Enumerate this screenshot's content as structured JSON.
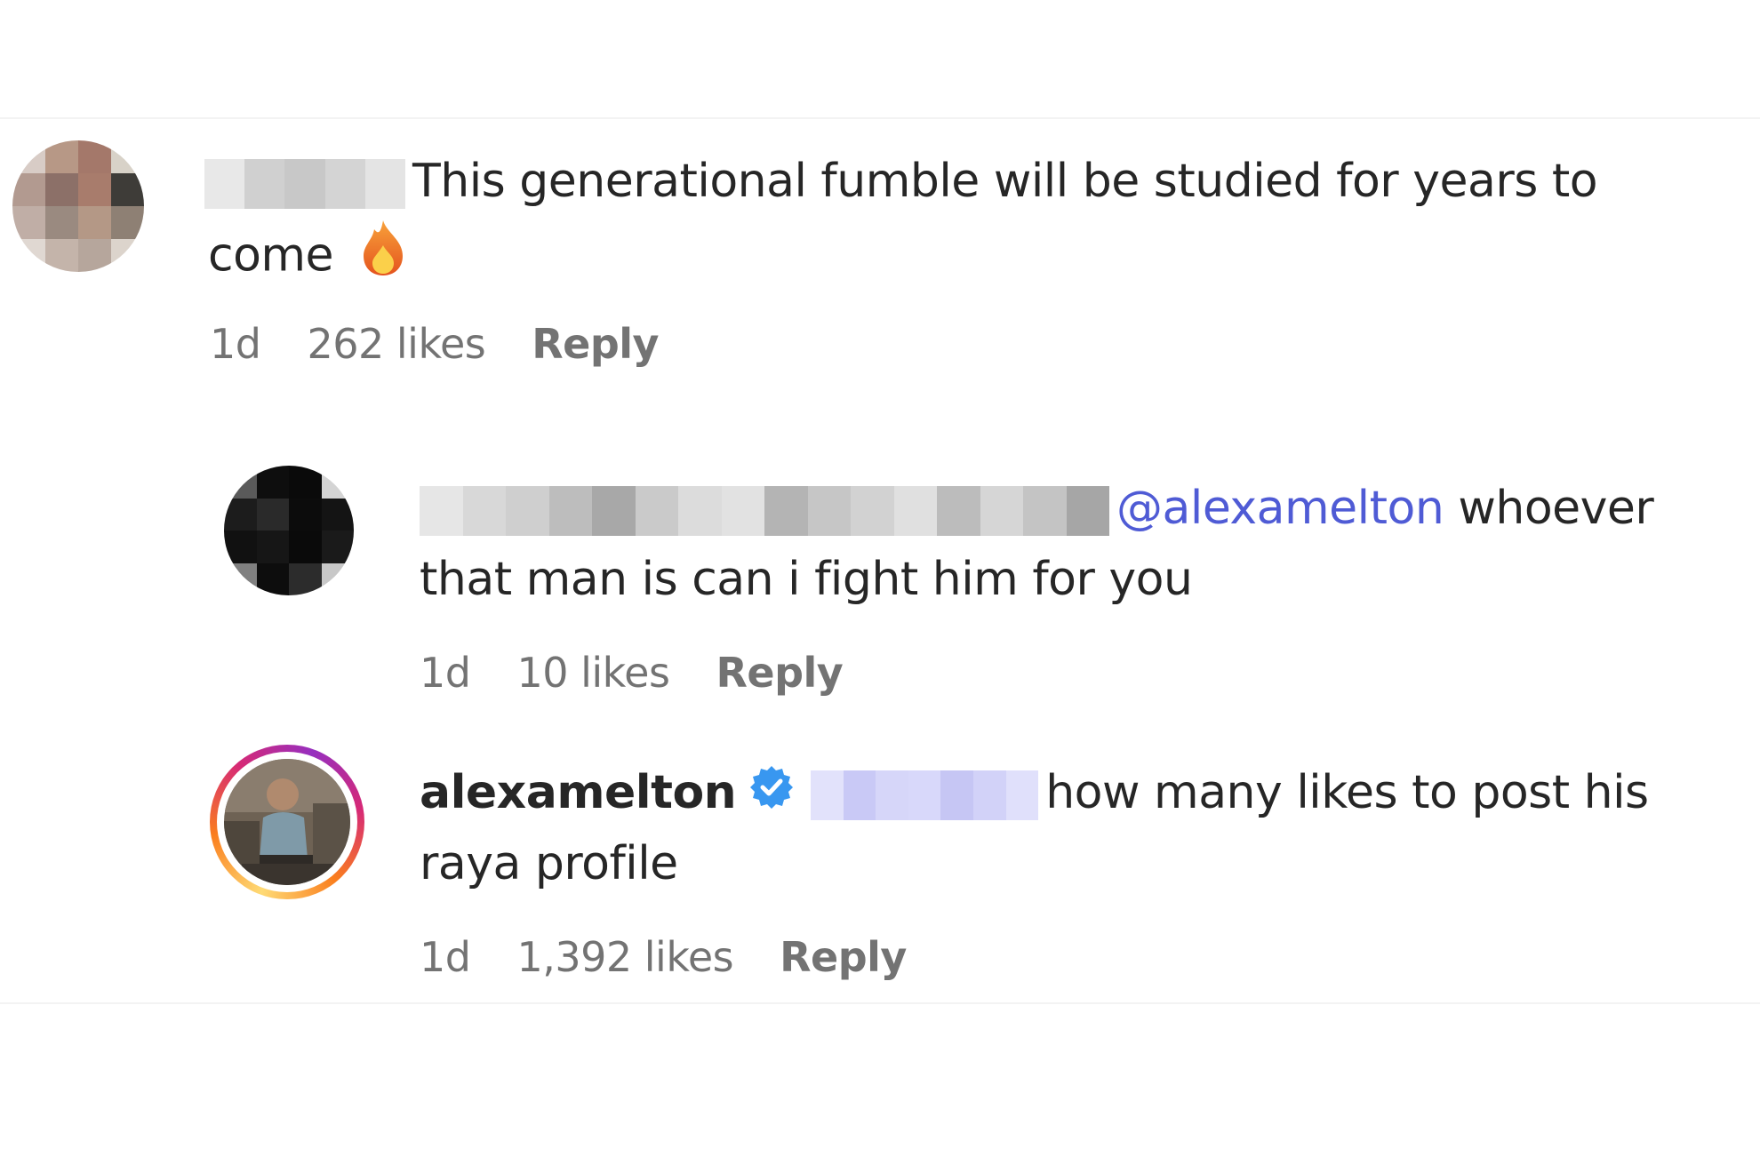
{
  "comments": [
    {
      "text": "This generational fumble will be studied for years to",
      "text_cont": "come",
      "emoji": "fire-icon",
      "time": "1d",
      "likes": "262 likes",
      "reply": "Reply"
    },
    {
      "mention": "@alexamelton",
      "text": " whoever",
      "text_cont": "that man is can i fight him for you",
      "time": "1d",
      "likes": "10 likes",
      "reply": "Reply"
    },
    {
      "username": "alexamelton",
      "verified_icon": "verified-badge-icon",
      "text": "how many likes to post his",
      "text_cont": "raya profile",
      "time": "1d",
      "likes": "1,392 likes",
      "reply": "Reply"
    }
  ],
  "colors": {
    "mention": "#4f5bd5",
    "verified": "#3897f0",
    "meta": "#737373",
    "text": "#262626"
  }
}
